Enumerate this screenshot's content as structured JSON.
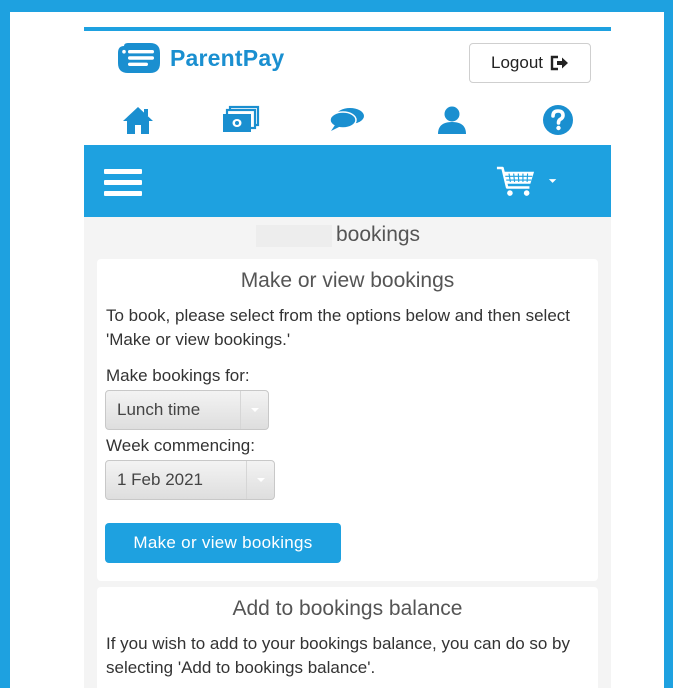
{
  "brand": {
    "name": "ParentPay",
    "color": "#1a8fd0"
  },
  "header": {
    "logout_label": "Logout",
    "nav_icons": [
      "home-icon",
      "payments-icon",
      "messages-icon",
      "profile-icon",
      "help-icon"
    ]
  },
  "bar": {
    "color": "#1ea1e0",
    "menu_icon": "hamburger-icon",
    "cart_icon": "cart-icon"
  },
  "page": {
    "title": "bookings"
  },
  "make_card": {
    "title": "Make or view bookings",
    "instruction": "To book, please select from the options below and then select 'Make or view bookings.'",
    "for_label": "Make bookings for:",
    "for_value": "Lunch time",
    "week_label": "Week commencing:",
    "week_value": "1 Feb 2021",
    "button_label": "Make or view bookings"
  },
  "balance_card": {
    "title": "Add to bookings balance",
    "text": "If you wish to add to your bookings balance, you can do so by selecting 'Add to bookings balance'."
  }
}
